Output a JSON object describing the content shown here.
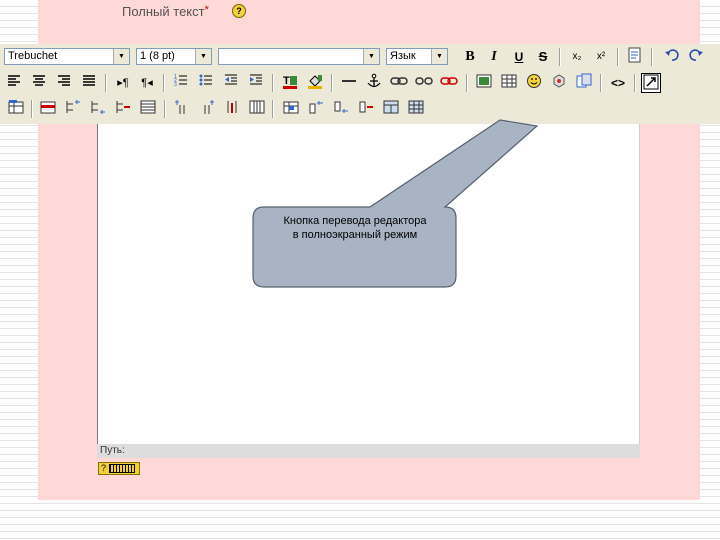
{
  "field": {
    "label": "Полный текст",
    "required_mark": "*",
    "help_glyph": "?"
  },
  "toolbar": {
    "font_name": "Trebuchet",
    "font_size": "1 (8 pt)",
    "format": "",
    "language": "Язык",
    "bold": "B",
    "italic": "I",
    "underline": "U",
    "strike": "S",
    "subscript": "x₂",
    "superscript": "x²",
    "source": "<>"
  },
  "editor": {
    "path_label": "Путь:",
    "help_glyph": "?"
  },
  "callout": {
    "line1": "Кнопка перевода редактора",
    "line2": "в полноэкранный режим"
  },
  "colors": {
    "panel": "#ffd8d8",
    "toolbar": "#ece9d8",
    "callout_fill": "#a8b4c4",
    "callout_border": "#55606e"
  }
}
